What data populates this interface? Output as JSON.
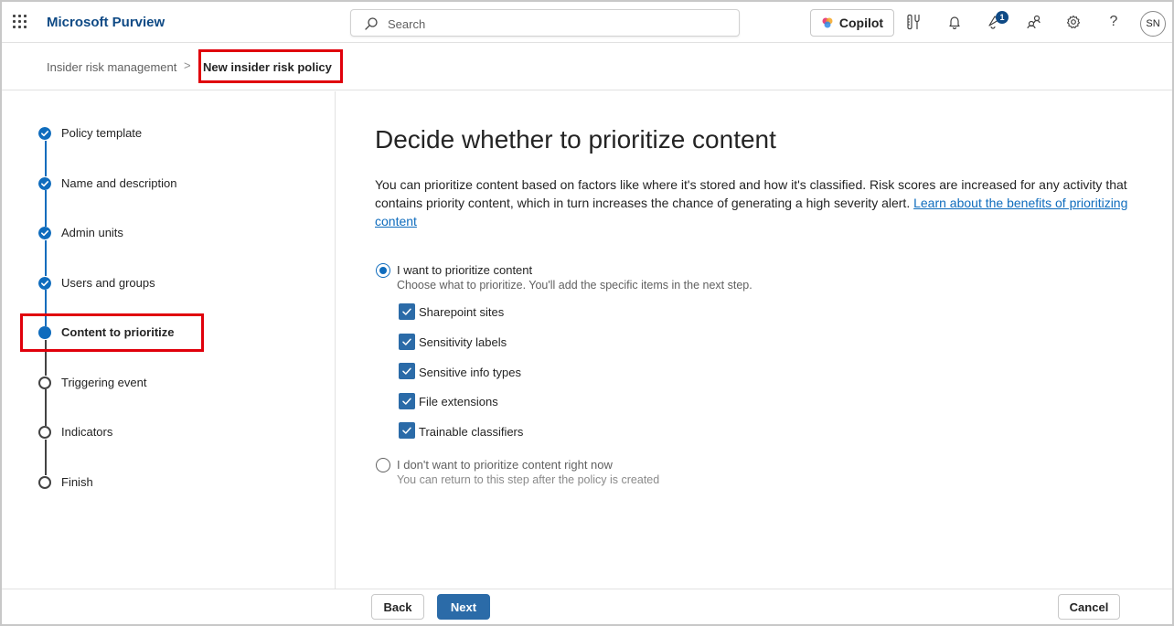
{
  "header": {
    "app_title": "Microsoft Purview",
    "search_placeholder": "Search",
    "copilot_label": "Copilot",
    "notification_badge": "1",
    "avatar_initials": "SN",
    "icons": [
      "app-launcher-icon",
      "search-icon",
      "copilot-icon",
      "tools-icon",
      "bell-icon",
      "alert-icon",
      "people-icon",
      "gear-icon",
      "help-icon"
    ]
  },
  "breadcrumb": {
    "parent": "Insider risk management",
    "separator": ">",
    "current": "New insider risk policy"
  },
  "steps": [
    {
      "label": "Policy template",
      "state": "done"
    },
    {
      "label": "Name and description",
      "state": "done"
    },
    {
      "label": "Admin units",
      "state": "done"
    },
    {
      "label": "Users and groups",
      "state": "done"
    },
    {
      "label": "Content to prioritize",
      "state": "current"
    },
    {
      "label": "Triggering event",
      "state": "todo"
    },
    {
      "label": "Indicators",
      "state": "todo"
    },
    {
      "label": "Finish",
      "state": "todo"
    }
  ],
  "main": {
    "title": "Decide whether to prioritize content",
    "description": "You can prioritize content based on factors like where it's stored and how it's classified. Risk scores are increased for any activity that contains priority content, which in turn increases the chance of generating a high severity alert.",
    "learn_link": "Learn about the benefits of prioritizing content",
    "option_yes": {
      "label": "I want to prioritize content",
      "sublabel": "Choose what to prioritize. You'll add the specific items in the next step.",
      "selected": true
    },
    "checkboxes": [
      {
        "label": "Sharepoint sites",
        "checked": true
      },
      {
        "label": "Sensitivity labels",
        "checked": true
      },
      {
        "label": "Sensitive info types",
        "checked": true
      },
      {
        "label": "File extensions",
        "checked": true
      },
      {
        "label": "Trainable classifiers",
        "checked": true
      }
    ],
    "option_no": {
      "label": "I don't want to prioritize content right now",
      "sublabel": "You can return to this step after the policy is created",
      "selected": false
    }
  },
  "footer": {
    "back_label": "Back",
    "next_label": "Next",
    "cancel_label": "Cancel"
  },
  "colors": {
    "brand": "#0f4a85",
    "accent": "#0f6cbd",
    "primary_button": "#2b6ba8",
    "highlight": "#e0000b"
  }
}
